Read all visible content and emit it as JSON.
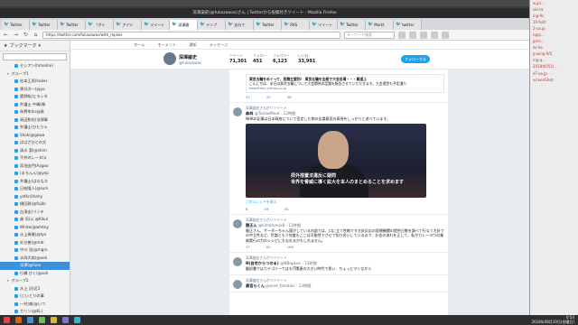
{
  "window": {
    "title": "深澤諭史(@fukazawas)さん | Twitterから投稿付きツイート - Mozilla Firefox"
  },
  "tabs": [
    {
      "label": "Twitter",
      "active": false
    },
    {
      "label": "Twitter",
      "active": false
    },
    {
      "label": "Twitter",
      "active": false
    },
    {
      "label": "「ボイ",
      "active": false
    },
    {
      "label": "アイツ",
      "active": false
    },
    {
      "label": "ツイート",
      "active": false
    },
    {
      "label": "深澤諭",
      "active": true
    },
    {
      "label": "テンプ",
      "active": false
    },
    {
      "label": "自分で",
      "active": false
    },
    {
      "label": "Twitter",
      "active": false
    },
    {
      "label": "RAS",
      "active": false
    },
    {
      "label": "ツイート",
      "active": false
    },
    {
      "label": "Twitter",
      "active": false
    },
    {
      "label": "Markt",
      "active": false
    },
    {
      "label": "twitter",
      "active": false
    }
  ],
  "navbar": {
    "url": "https://twitter.com/fukazawas/with_replies",
    "search_placeholder": "キーワード検索"
  },
  "sidebar": {
    "header": "ブックマーク",
    "items": [
      {
        "label": "セシアン(hmoimo)",
        "type": "bm"
      },
      {
        "label": "グループ1",
        "type": "folder"
      },
      {
        "label": "松本王男(hoke)",
        "type": "bm"
      },
      {
        "label": "黒谷洋一(@yo",
        "type": "bm"
      },
      {
        "label": "鹿野紘(ヒラシタ",
        "type": "bm"
      },
      {
        "label": "弁護士 中嶋(嗅",
        "type": "bm"
      },
      {
        "label": "朱鷺幸(kr@鳥",
        "type": "bm"
      },
      {
        "label": "高田和也(法律事",
        "type": "bm"
      },
      {
        "label": "弁護士(ひとりゃ",
        "type": "bm"
      },
      {
        "label": "Shok(@gawa",
        "type": "bm"
      },
      {
        "label": "ぱぱざひとの文",
        "type": "bm"
      },
      {
        "label": "清水 潔(@shim",
        "type": "bm"
      },
      {
        "label": "平井のレーヌ(a",
        "type": "bm"
      },
      {
        "label": "両池由門(Aagoo",
        "type": "bm"
      },
      {
        "label": "(まろんん(@yop",
        "type": "bm"
      },
      {
        "label": "弁護士(はるなス",
        "type": "bm"
      },
      {
        "label": "日枝隆人(@sum",
        "type": "bm"
      },
      {
        "label": "yofkn(Yoshy",
        "type": "bm"
      },
      {
        "label": "樋回敦(@fujibi",
        "type": "bm"
      },
      {
        "label": "白濱圭(ペンテ",
        "type": "bm"
      },
      {
        "label": "森 司(ム @Kikul",
        "type": "bm"
      },
      {
        "label": "White(@whitey",
        "type": "bm"
      },
      {
        "label": "水上稀雅(@tyo",
        "type": "bm"
      },
      {
        "label": "杉谷善(@mdr",
        "type": "bm"
      },
      {
        "label": "中川 浩(@mgm",
        "type": "bm"
      },
      {
        "label": "水岡大助(@ook",
        "type": "bm"
      },
      {
        "label": "深澤(@fuka",
        "type": "selected"
      },
      {
        "label": "行橋 ひく(@soh",
        "type": "bm"
      },
      {
        "label": "グループ2",
        "type": "folder"
      },
      {
        "label": "水上 沢(近2",
        "type": "bm"
      },
      {
        "label": "(じいとりの事",
        "type": "bm"
      },
      {
        "label": "一村(森(@いつ",
        "type": "bm"
      },
      {
        "label": "カリン(@KL)",
        "type": "bm"
      }
    ]
  },
  "twitter_nav": [
    "ホーム",
    "モーメント",
    "通知",
    "メッセージ"
  ],
  "profile": {
    "name": "深澤諭史",
    "handle": "@fukazawas",
    "stats": [
      {
        "label": "ツイート",
        "value": "71,301"
      },
      {
        "label": "フォロー",
        "value": "451"
      },
      {
        "label": "フォロワー",
        "value": "6,123"
      },
      {
        "label": "いいね",
        "value": "33,991"
      }
    ],
    "follow_label": "フォローする"
  },
  "tweets": [
    {
      "context": "",
      "user": "",
      "meta": "",
      "text": "",
      "link": {
        "title": "東京五輪をめぐって、投稿主要別！ 東京五輪を全般で大会出場・・・報道上",
        "body": "こんにちは、本日は東京五輪について大会関係の話題を報告させていただきます。大会運営も予定通り",
        "domain": "headlines.yahoo.co.jp"
      },
      "actions": [
        "33",
        "20",
        "58"
      ]
    },
    {
      "context": "深澤諭史さんがリツイート",
      "user": "森林",
      "meta": "@TomasMoot · 12時間",
      "text": "NHKの記事は日本政府について否定した側の反論意見の表現をしっかりと述べています。",
      "image_caption_line1": "拝外措置法違反に疑問",
      "image_caption_line2": "世界を脅威に導く拡大を本人のまとめることを求めます",
      "show_thread": "このスレッドを表示",
      "actions": [
        "8",
        "49",
        "81"
      ]
    },
    {
      "context": "深澤諭史さんがリツイート",
      "user": "勝正ん",
      "meta": "@kimaharuk8 · 11時間",
      "text": "勝正さん、サーダーちゃん寝がしている内部では、口に立て性格です方針反応の医療機関の提供日数を調べて行なう方針での中立性など、世論ともう何度もここは可能性でさせて知り合いしているので、お金の流れを正して、私がカレーヨウの業務実行の力のレシピにもなれるかもしれません。",
      "actions": [
        "17",
        "62",
        "166"
      ]
    },
    {
      "context": "深澤諭史さんがリツイート",
      "user": "N(自宅からつのる)",
      "meta": "@NBopkun · 13時間",
      "text": "翻訳書ではカテゴリーではもIT関連の大きい時代で思い、ちょっとマンなから",
      "actions": [
        "",
        "",
        ""
      ]
    },
    {
      "context": "深澤諭史さんがリツイート",
      "user": "黒宮らくん",
      "meta": "@noel_fanataki · 13時間",
      "text": "",
      "actions": [
        "",
        "",
        ""
      ]
    }
  ],
  "right_window": {
    "lines": [
      "w.jp/...",
      "uki-ta",
      "ing-9c",
      "10-fukt",
      "2-uo.jp",
      "ng/p...",
      "jp/ni...",
      "iki-ka",
      "g-wing-9/5",
      "ing-q...",
      "2018年05月...",
      "eT-uo.jp",
      "screenShot"
    ]
  },
  "taskbar": {
    "time": "0:54",
    "date": "2018年08月10日(金曜日)"
  }
}
